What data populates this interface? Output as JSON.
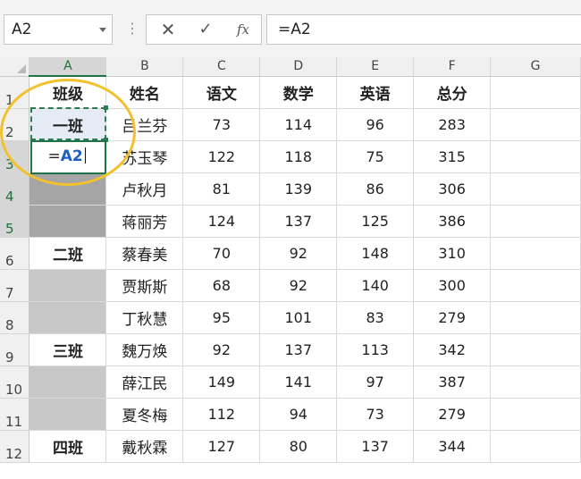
{
  "formula_bar": {
    "name_box": "A2",
    "dots": "⋮",
    "cancel_icon": "✕",
    "enter_icon": "✓",
    "fx_label": "fx",
    "formula": "=A2"
  },
  "columns": [
    "A",
    "B",
    "C",
    "D",
    "E",
    "F",
    "G"
  ],
  "rows": [
    "1",
    "2",
    "3",
    "4",
    "5",
    "6",
    "7",
    "8",
    "9",
    "10",
    "11",
    "12"
  ],
  "header": [
    "班级",
    "姓名",
    "语文",
    "数学",
    "英语",
    "总分"
  ],
  "edit": {
    "prefix": "=",
    "ref": "A2"
  },
  "data": [
    {
      "cls": "一班",
      "name": "吕兰芬",
      "yw": "73",
      "sx": "114",
      "yy": "96",
      "zf": "283"
    },
    {
      "cls": "",
      "name": "苏玉琴",
      "yw": "122",
      "sx": "118",
      "yy": "75",
      "zf": "315"
    },
    {
      "cls": "",
      "name": "卢秋月",
      "yw": "81",
      "sx": "139",
      "yy": "86",
      "zf": "306"
    },
    {
      "cls": "",
      "name": "蒋丽芳",
      "yw": "124",
      "sx": "137",
      "yy": "125",
      "zf": "386"
    },
    {
      "cls": "二班",
      "name": "蔡春美",
      "yw": "70",
      "sx": "92",
      "yy": "148",
      "zf": "310"
    },
    {
      "cls": "",
      "name": "贾斯斯",
      "yw": "68",
      "sx": "92",
      "yy": "140",
      "zf": "300"
    },
    {
      "cls": "",
      "name": "丁秋慧",
      "yw": "95",
      "sx": "101",
      "yy": "83",
      "zf": "279"
    },
    {
      "cls": "三班",
      "name": "魏万焕",
      "yw": "92",
      "sx": "137",
      "yy": "113",
      "zf": "342"
    },
    {
      "cls": "",
      "name": "薛江民",
      "yw": "149",
      "sx": "141",
      "yy": "97",
      "zf": "387"
    },
    {
      "cls": "",
      "name": "夏冬梅",
      "yw": "112",
      "sx": "94",
      "yy": "73",
      "zf": "279"
    },
    {
      "cls": "四班",
      "name": "戴秋霖",
      "yw": "127",
      "sx": "80",
      "yy": "137",
      "zf": "344"
    }
  ],
  "colors": {
    "accent": "#217346",
    "highlight": "#f2c12e",
    "reference": "#1f5fbf"
  }
}
